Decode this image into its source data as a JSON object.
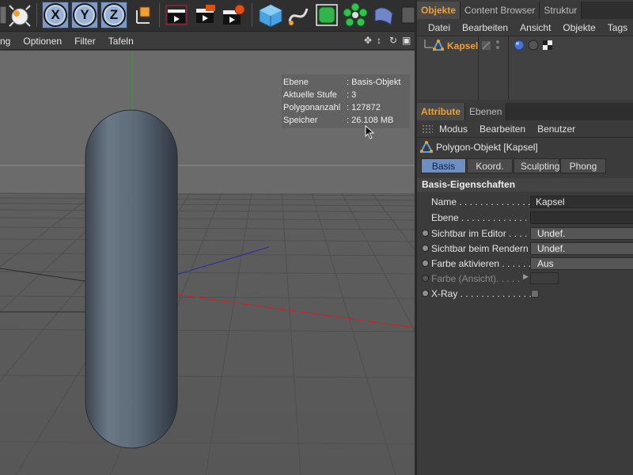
{
  "toolbar": {
    "axis_buttons": [
      "X",
      "Y",
      "Z"
    ]
  },
  "viewport_menu": {
    "items": [
      "ng",
      "Optionen",
      "Filter",
      "Tafeln"
    ]
  },
  "hud": {
    "rows": [
      {
        "key": "Ebene",
        "value": ": Basis-Objekt"
      },
      {
        "key": "Aktuelle Stufe",
        "value": ": 3"
      },
      {
        "key": "Polygonanzahl",
        "value": ": 127872"
      },
      {
        "key": "Speicher",
        "value": ": 26.108 MB"
      }
    ]
  },
  "objects_panel": {
    "tabs": [
      "Objekte",
      "Content Browser",
      "Struktur"
    ],
    "active_tab": "Objekte",
    "menu": [
      "Datei",
      "Bearbeiten",
      "Ansicht",
      "Objekte",
      "Tags"
    ],
    "object_name": "Kapsel"
  },
  "attribute_panel": {
    "tabs": [
      "Attribute",
      "Ebenen"
    ],
    "active_tab": "Attribute",
    "menu": [
      "Modus",
      "Bearbeiten",
      "Benutzer"
    ],
    "object_title": "Polygon-Objekt [Kapsel]",
    "sub_tabs": [
      "Basis",
      "Koord.",
      "Sculpting",
      "Phong"
    ],
    "active_sub_tab": "Basis",
    "section_title": "Basis-Eigenschaften",
    "properties": {
      "name_label": "Name . . . . . . . . . . . . . . .",
      "name_value": "Kapsel",
      "ebene_label": "Ebene . . . . . . . . . . . . . . .",
      "ebene_value": "",
      "sichtbar_editor_label": "Sichtbar im Editor . . . . .",
      "sichtbar_editor_value": "Undef.",
      "sichtbar_render_label": "Sichtbar beim Rendern",
      "sichtbar_render_value": "Undef.",
      "farbe_akt_label": "Farbe aktivieren . . . . . . .",
      "farbe_akt_value": "Aus",
      "farbe_ansicht_label": "Farbe (Ansicht). . . . .",
      "xray_label": "X-Ray . . . . . . . . . . . . . . ."
    }
  },
  "colors": {
    "accent_orange": "#f0a030",
    "tab_active_blue": "#6d8fc4",
    "axis_blue": "#9bb4d6"
  }
}
